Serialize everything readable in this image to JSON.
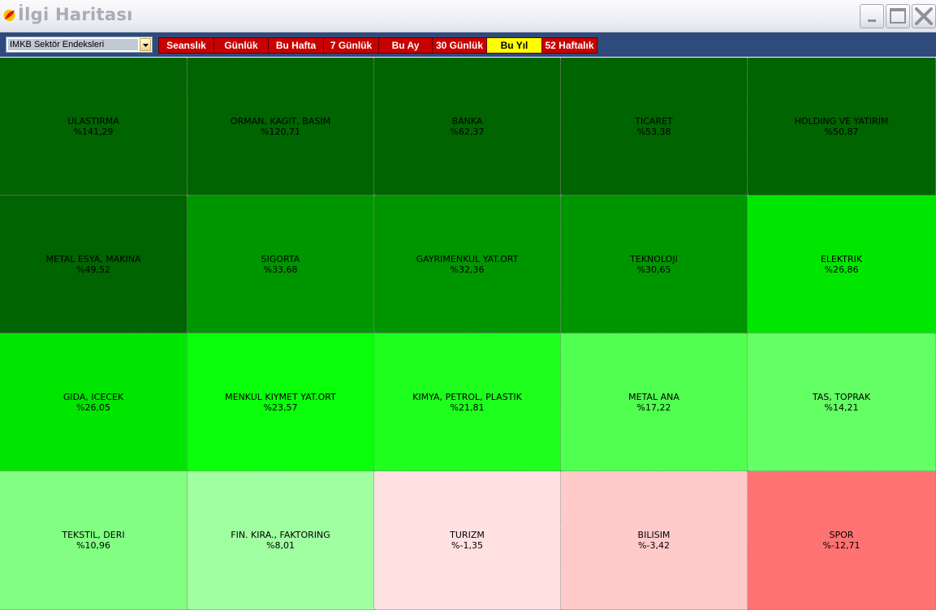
{
  "window": {
    "title": "İlgi Haritası"
  },
  "toolbar": {
    "index_selector": {
      "value": "IMKB Sektör Endeksleri"
    },
    "periods": [
      {
        "label": "Seanslık",
        "active": false
      },
      {
        "label": "Günlük",
        "active": false
      },
      {
        "label": "Bu Hafta",
        "active": false
      },
      {
        "label": "7 Günlük",
        "active": false
      },
      {
        "label": "Bu Ay",
        "active": false
      },
      {
        "label": "30 Günlük",
        "active": false
      },
      {
        "label": "Bu Yıl",
        "active": true
      },
      {
        "label": "52 Haftalık",
        "active": false
      }
    ]
  },
  "colors": {
    "active_tab": "#ffff00",
    "inactive_tab": "#c80000",
    "toolbar_bg": "#2f4b7c"
  },
  "heatmap": {
    "cells": [
      {
        "name": "ULASTIRMA",
        "value": "%141,29",
        "color": "#006400"
      },
      {
        "name": "ORMAN, KAGIT, BASIM",
        "value": "%120,71",
        "color": "#006400"
      },
      {
        "name": "BANKA",
        "value": "%62,37",
        "color": "#006400"
      },
      {
        "name": "TICARET",
        "value": "%53,38",
        "color": "#006400"
      },
      {
        "name": "HOLDING VE YATIRIM",
        "value": "%50,87",
        "color": "#006400"
      },
      {
        "name": "METAL ESYA, MAKINA",
        "value": "%49,52",
        "color": "#006400"
      },
      {
        "name": "SIGORTA",
        "value": "%33,68",
        "color": "#009600"
      },
      {
        "name": "GAYRIMENKUL YAT.ORT",
        "value": "%32,36",
        "color": "#009600"
      },
      {
        "name": "TEKNOLOJI",
        "value": "%30,65",
        "color": "#009600"
      },
      {
        "name": "ELEKTRIK",
        "value": "%26,86",
        "color": "#00e600"
      },
      {
        "name": "GIDA, ICECEK",
        "value": "%26,05",
        "color": "#00e600"
      },
      {
        "name": "MENKUL KIYMET YAT.ORT",
        "value": "%23,57",
        "color": "#0aff0a"
      },
      {
        "name": "KIMYA, PETROL, PLASTIK",
        "value": "%21,81",
        "color": "#1eff1e"
      },
      {
        "name": "METAL ANA",
        "value": "%17,22",
        "color": "#50ff50"
      },
      {
        "name": "TAS, TOPRAK",
        "value": "%14,21",
        "color": "#64ff64"
      },
      {
        "name": "TEKSTIL, DERI",
        "value": "%10,96",
        "color": "#82ff82"
      },
      {
        "name": "FIN. KIRA., FAKTORING",
        "value": "%8,01",
        "color": "#a0ffa0"
      },
      {
        "name": "TURIZM",
        "value": "%-1,35",
        "color": "#ffe1e1"
      },
      {
        "name": "BILISIM",
        "value": "%-3,42",
        "color": "#ffcaca"
      },
      {
        "name": "SPOR",
        "value": "%-12,71",
        "color": "#ff7272"
      }
    ]
  }
}
